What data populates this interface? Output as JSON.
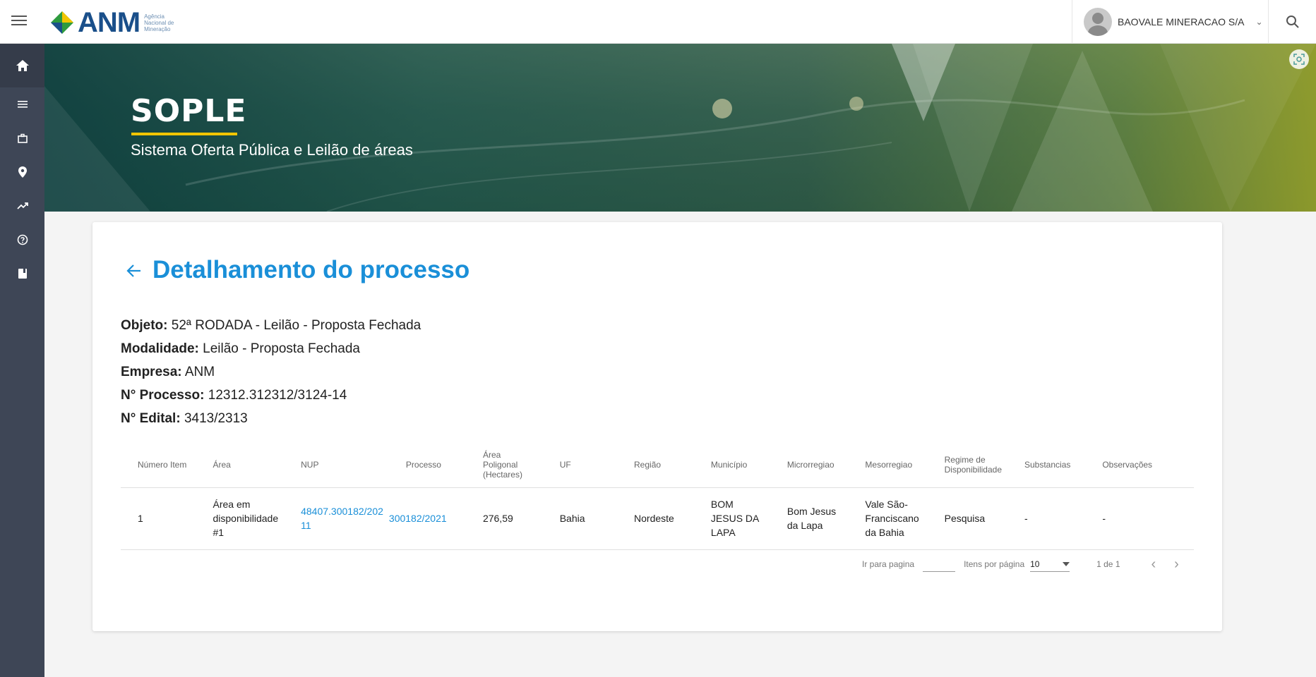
{
  "header": {
    "logo_text": "ANM",
    "logo_subtitle": "Agência Nacional de Mineração",
    "user_name": "BAOVALE MINERACAO S/A"
  },
  "sidebar": {
    "items": [
      {
        "icon": "home-icon"
      },
      {
        "icon": "list-icon"
      },
      {
        "icon": "briefcase-icon"
      },
      {
        "icon": "map-pin-icon"
      },
      {
        "icon": "trending-up-icon"
      },
      {
        "icon": "help-icon"
      },
      {
        "icon": "book-icon"
      }
    ]
  },
  "banner": {
    "title": "SOPLE",
    "subtitle": "Sistema Oferta Pública e Leilão de áreas"
  },
  "page": {
    "title": "Detalhamento do processo",
    "info": [
      {
        "label": "Objeto:",
        "value": "52ª RODADA - Leilão - Proposta Fechada"
      },
      {
        "label": "Modalidade:",
        "value": "Leilão - Proposta Fechada"
      },
      {
        "label": "Empresa:",
        "value": "ANM"
      },
      {
        "label": "N° Processo:",
        "value": "12312.312312/3124-14"
      },
      {
        "label": "N° Edital:",
        "value": "3413/2313"
      }
    ]
  },
  "table": {
    "headers": [
      "Número Item",
      "Área",
      "NUP",
      "Processo",
      "Área Poligonal (Hectares)",
      "UF",
      "Região",
      "Município",
      "Microrregiao",
      "Mesorregiao",
      "Regime de Disponibilidade",
      "Substancias",
      "Observações"
    ],
    "rows": [
      {
        "numero_item": "1",
        "area": "Área em disponibilidade #1",
        "nup": "48407.300182/2021-11",
        "nup_line1": "48407.300182/202",
        "nup_line2": "11",
        "processo": "300182/2021",
        "area_poligonal": "276,59",
        "uf": "Bahia",
        "regiao": "Nordeste",
        "municipio": "BOM JESUS DA LAPA",
        "microrregiao": "Bom Jesus da Lapa",
        "mesorregiao": "Vale São-Franciscano da Bahia",
        "regime": "Pesquisa",
        "substancias": "-",
        "observacoes": "-"
      }
    ]
  },
  "pagination": {
    "goto_label": "Ir para pagina",
    "goto_value": "",
    "per_page_label": "Itens por página",
    "per_page_value": "10",
    "range_text": "1 de 1"
  },
  "colors": {
    "accent": "#1a8fd8",
    "sidebar": "#3e4656",
    "brand_yellow": "#f2c500"
  }
}
